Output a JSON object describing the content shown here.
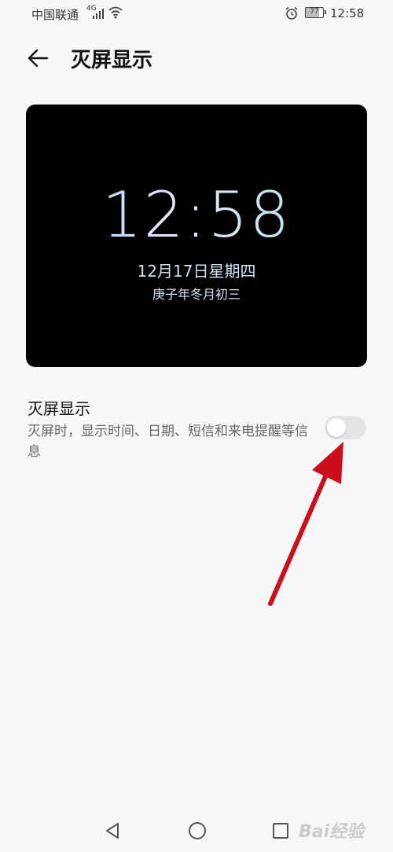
{
  "status_bar": {
    "carrier": "中国联通",
    "network_type": "4G",
    "battery_level": "77",
    "time": "12:58",
    "icons": [
      "signal-icon",
      "wifi-icon",
      "alarm-icon",
      "battery-icon"
    ]
  },
  "header": {
    "title": "灭屏显示",
    "back_icon": "arrow-left-icon"
  },
  "preview": {
    "time": "12:58",
    "date": "12月17日星期四",
    "lunar": "庚子年冬月初三"
  },
  "setting": {
    "title": "灭屏显示",
    "description": "灭屏时，显示时间、日期、短信和来电提醒等信息",
    "toggle_on": false
  },
  "nav": {
    "icons": [
      "back-triangle-icon",
      "home-circle-icon",
      "recents-square-icon"
    ]
  },
  "watermark": "Bai经验",
  "colors": {
    "background": "#f7f7f7",
    "annotation_arrow": "#cc0e1b",
    "toggle_off": "#e4e4e4"
  }
}
